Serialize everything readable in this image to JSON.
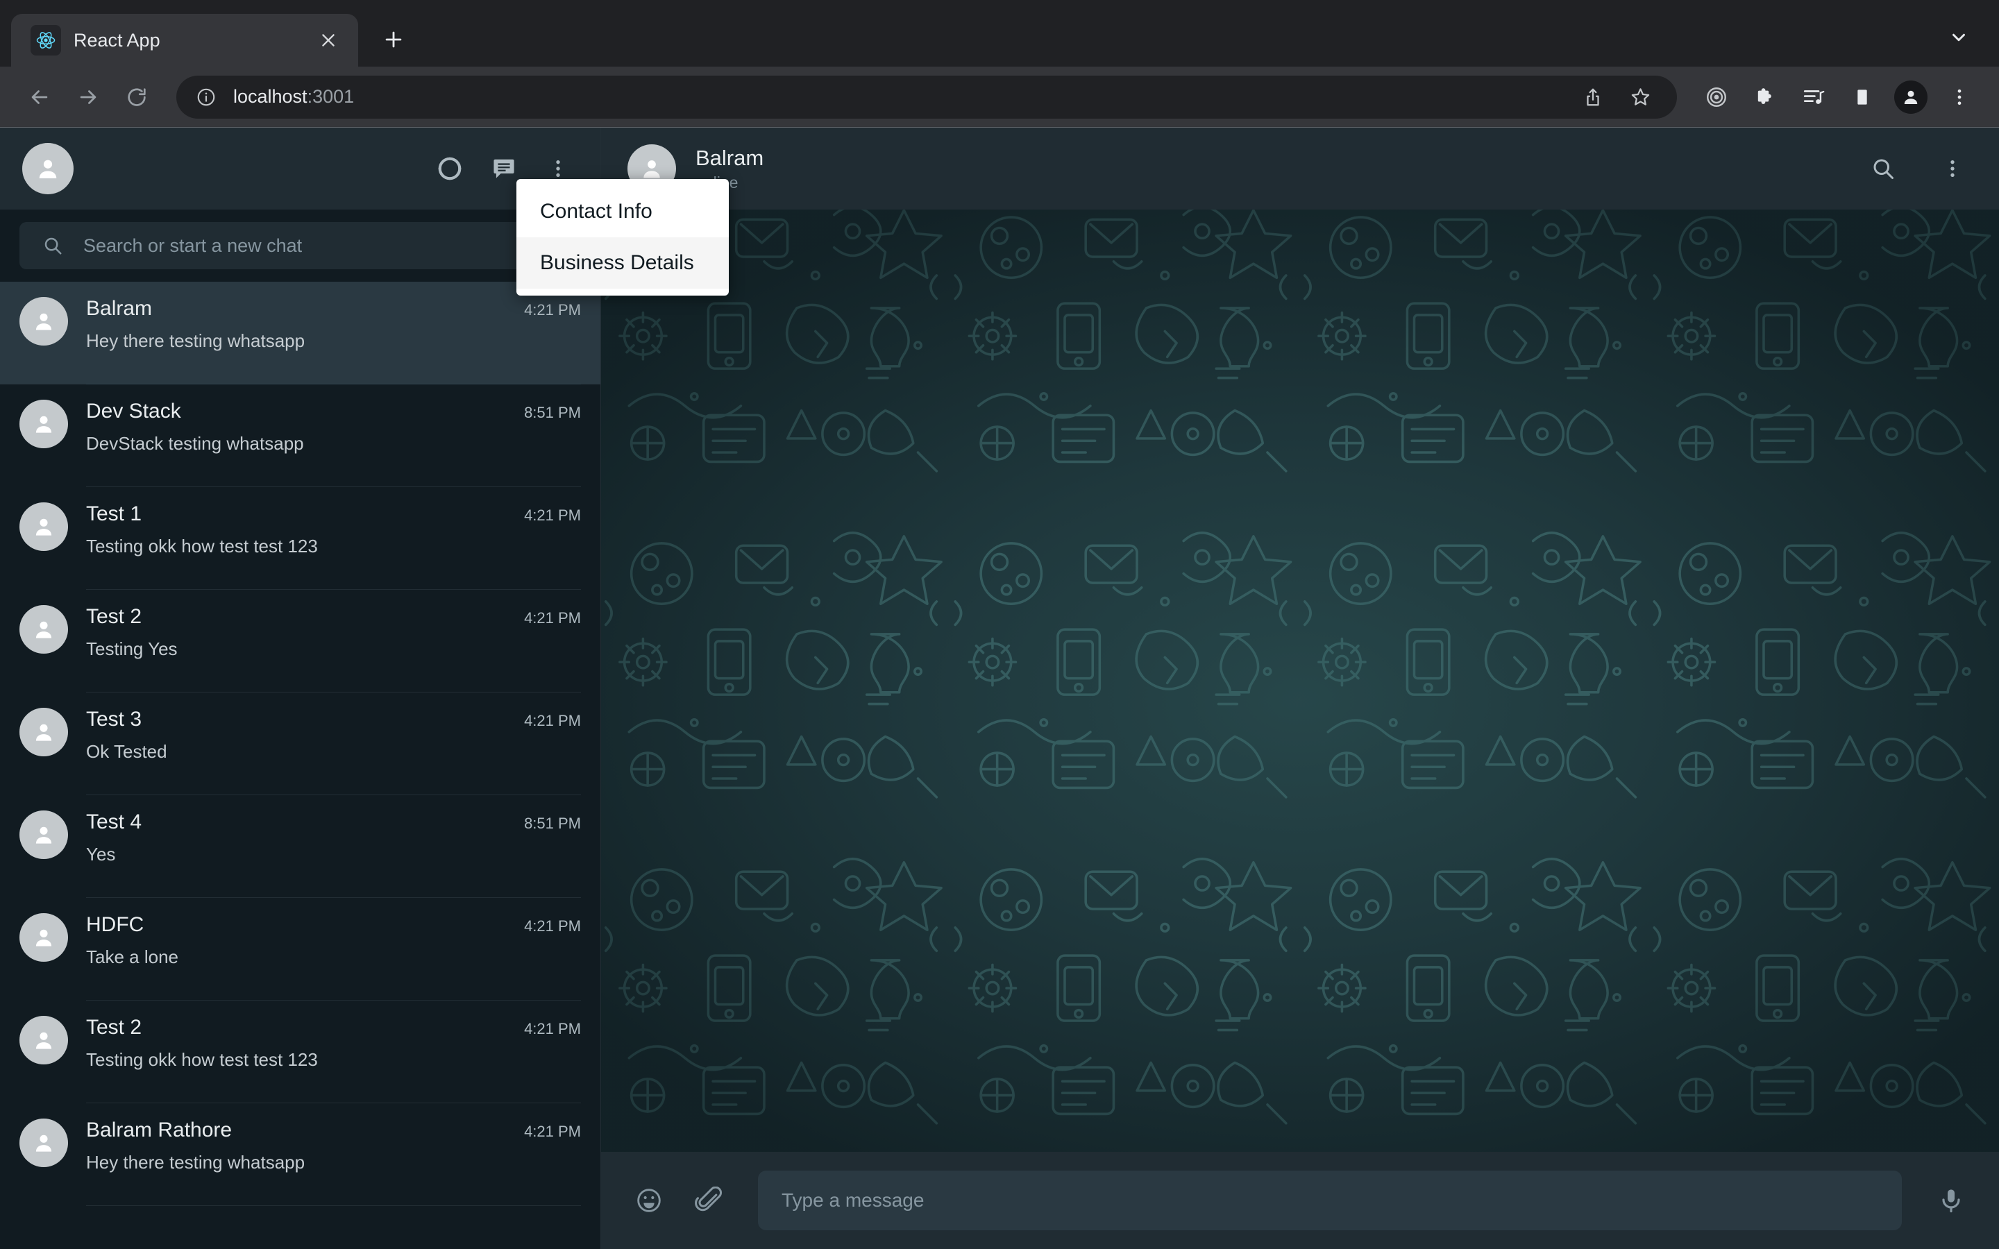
{
  "browser": {
    "tab": {
      "title": "React App",
      "favicon_icon": "react-logo-icon",
      "close_icon": "close-icon"
    },
    "new_tab_label": "+",
    "tab_search_icon": "chevron-down-icon",
    "nav": {
      "back_icon": "back-arrow-icon",
      "forward_icon": "forward-arrow-icon",
      "reload_icon": "reload-icon"
    },
    "omnibox": {
      "info_icon": "info-circle-icon",
      "url_host": "localhost",
      "url_port": ":3001",
      "share_icon": "share-icon",
      "bookmark_icon": "star-icon"
    },
    "toolbar_icons": [
      {
        "name": "privacy-target-icon"
      },
      {
        "name": "extensions-puzzle-icon"
      },
      {
        "name": "media-playlist-icon"
      },
      {
        "name": "side-panel-icon"
      },
      {
        "name": "profile-avatar-icon"
      },
      {
        "name": "browser-menu-icon"
      }
    ]
  },
  "sidebar": {
    "header": {
      "avatar_icon": "user-avatar-icon",
      "status_icon": "status-ring-icon",
      "new_chat_icon": "new-chat-icon",
      "menu_icon": "overflow-menu-icon"
    },
    "search": {
      "icon": "search-icon",
      "placeholder": "Search or start a new chat",
      "value": ""
    },
    "chats": [
      {
        "name": "Balram",
        "message": "Hey there testing whatsapp",
        "time": "4:21 PM",
        "selected": true
      },
      {
        "name": "Dev Stack",
        "message": "DevStack testing whatsapp",
        "time": "8:51 PM",
        "selected": false
      },
      {
        "name": "Test 1",
        "message": "Testing okk how test test 123",
        "time": "4:21 PM",
        "selected": false
      },
      {
        "name": "Test 2",
        "message": "Testing Yes",
        "time": "4:21 PM",
        "selected": false
      },
      {
        "name": "Test 3",
        "message": "Ok Tested",
        "time": "4:21 PM",
        "selected": false
      },
      {
        "name": "Test 4",
        "message": "Yes",
        "time": "8:51 PM",
        "selected": false
      },
      {
        "name": "HDFC",
        "message": "Take a lone",
        "time": "4:21 PM",
        "selected": false
      },
      {
        "name": "Test 2",
        "message": "Testing okk how test test 123",
        "time": "4:21 PM",
        "selected": false
      },
      {
        "name": "Balram Rathore",
        "message": "Hey there testing whatsapp",
        "time": "4:21 PM",
        "selected": false
      }
    ]
  },
  "dropdown_menu": {
    "items": [
      {
        "label": "Contact Info",
        "hovered": false
      },
      {
        "label": "Business Details",
        "hovered": true
      }
    ]
  },
  "chat_panel": {
    "header": {
      "avatar_icon": "user-avatar-icon",
      "name": "Balram",
      "status": "online",
      "search_icon": "search-icon",
      "menu_icon": "overflow-menu-icon"
    },
    "composer": {
      "emoji_icon": "emoji-smiley-icon",
      "attach_icon": "paperclip-icon",
      "placeholder": "Type a message",
      "value": "",
      "mic_icon": "microphone-icon"
    }
  },
  "colors": {
    "app_panel": "#202c33",
    "sidebar_bg": "#111b21",
    "selected_row": "#2a3942",
    "wallpaper_base": "#1e3439",
    "accent_text": "#e9edef",
    "muted_text": "#8696a0",
    "menu_bg": "#ffffff",
    "menu_hover": "#f5f5f5"
  }
}
